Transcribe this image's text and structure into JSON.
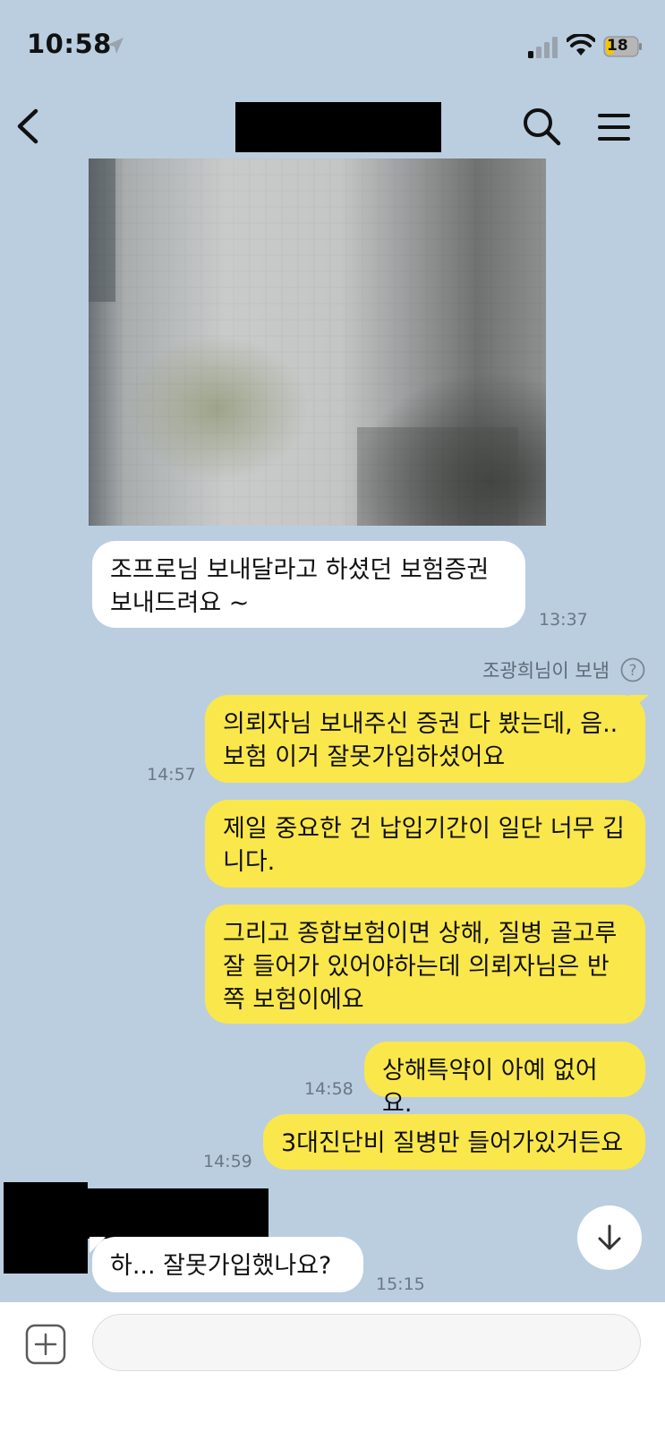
{
  "status_bar": {
    "time": "10:58",
    "battery": "18"
  },
  "header": {
    "title_redacted": true
  },
  "messages": [
    {
      "side": "in",
      "text": "조프로님 보내달라고 하셨던 보험증권\n보내드려요 ~",
      "time": "13:37"
    },
    {
      "side": "out",
      "text": "의뢰자님 보내주신 증권 다 봤는데, 음..\n보험 이거 잘못가입하셨어요",
      "time": "14:57"
    },
    {
      "side": "out",
      "text": "제일 중요한 건 납입기간이 일단 너무 깁\n니다.",
      "time": ""
    },
    {
      "side": "out",
      "text": "그리고 종합보험이면 상해, 질병 골고루\n잘 들어가 있어야하는데 의뢰자님은 반\n쪽 보험이에요",
      "time": ""
    },
    {
      "side": "out",
      "text": "상해특약이 아예 없어요.",
      "time": "14:58"
    },
    {
      "side": "out",
      "text": "3대진단비 질병만 들어가있거든요",
      "time": "14:59"
    },
    {
      "side": "in",
      "text": "하... 잘못가입했나요?",
      "time": "15:15"
    }
  ],
  "sender_note": "조광희님이 보냄",
  "input": {
    "placeholder": ""
  },
  "colors": {
    "background": "#bacee0",
    "outgoing": "#fae74b",
    "incoming": "#ffffff"
  }
}
